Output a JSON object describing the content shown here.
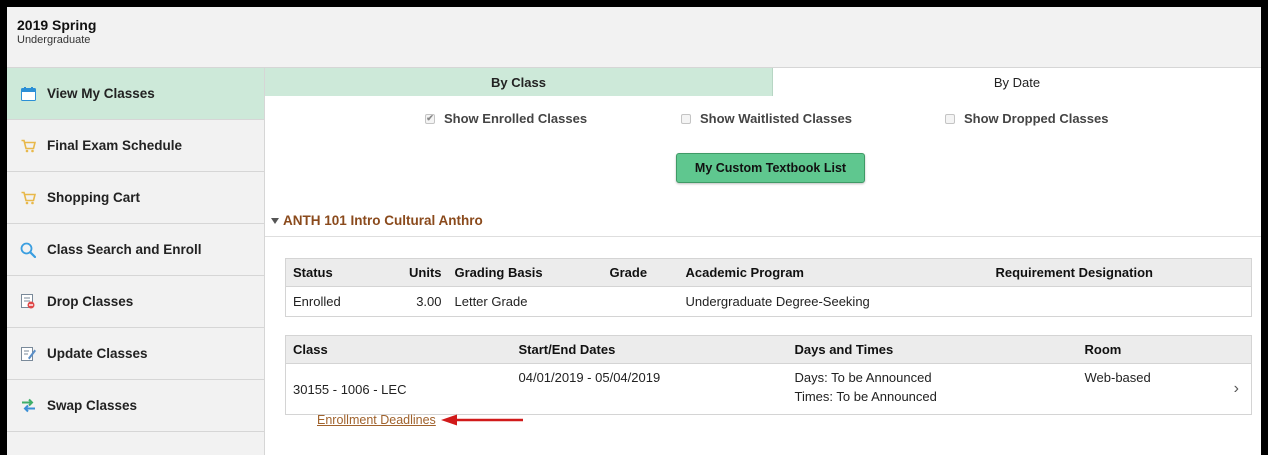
{
  "header": {
    "term": "2019 Spring",
    "career": "Undergraduate"
  },
  "sidebar": {
    "items": [
      {
        "label": "View My Classes",
        "icon": "calendar-icon",
        "active": true
      },
      {
        "label": "Final Exam Schedule",
        "icon": "cart-icon"
      },
      {
        "label": "Shopping Cart",
        "icon": "cart-icon"
      },
      {
        "label": "Class Search and Enroll",
        "icon": "search-icon"
      },
      {
        "label": "Drop Classes",
        "icon": "drop-icon"
      },
      {
        "label": "Update Classes",
        "icon": "edit-icon"
      },
      {
        "label": "Swap Classes",
        "icon": "swap-icon"
      }
    ]
  },
  "tabs": [
    {
      "label": "By Class",
      "active": true
    },
    {
      "label": "By Date"
    }
  ],
  "filters": [
    {
      "label": "Show Enrolled Classes",
      "checked": true
    },
    {
      "label": "Show Waitlisted Classes",
      "checked": false
    },
    {
      "label": "Show Dropped Classes",
      "checked": false
    }
  ],
  "textbook_button": "My Custom Textbook List",
  "course": {
    "title": "ANTH 101 Intro Cultural Anthro",
    "enrollment": {
      "headers": [
        "Status",
        "Units",
        "Grading Basis",
        "Grade",
        "Academic Program",
        "Requirement Designation"
      ],
      "row": [
        "Enrolled",
        "3.00",
        "Letter Grade",
        "",
        "Undergraduate Degree-Seeking",
        ""
      ]
    },
    "section": {
      "headers": [
        "Class",
        "Start/End Dates",
        "Days and Times",
        "Room"
      ],
      "class": "30155 - 1006 - LEC",
      "dates": "04/01/2019 - 05/04/2019",
      "days": "Days: To be Announced",
      "times": "Times: To be Announced",
      "room": "Web-based"
    }
  },
  "deadlines_link": "Enrollment Deadlines",
  "colors": {
    "active_green": "#cde9d9",
    "button_green": "#5fc78f",
    "link_brown": "#a0622c",
    "arrow_red": "#d11a1a"
  }
}
